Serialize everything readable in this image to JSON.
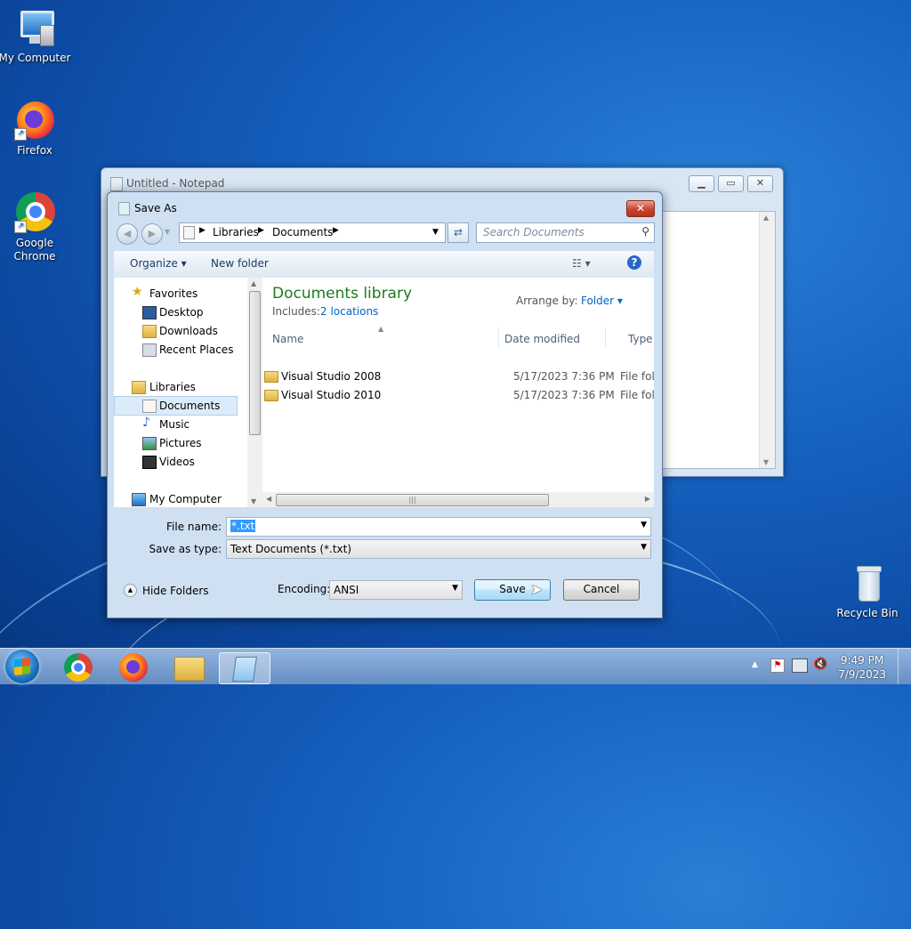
{
  "desktop": {
    "icons": [
      {
        "label": "My Computer",
        "icon": "computer-icon"
      },
      {
        "label": "Firefox",
        "icon": "firefox-icon"
      },
      {
        "label": "Google Chrome",
        "icon": "chrome-icon"
      },
      {
        "label": "Recycle Bin",
        "icon": "recycle-bin-icon"
      }
    ]
  },
  "notepad": {
    "title": "Untitled - Notepad"
  },
  "dialog": {
    "title": "Save As",
    "breadcrumb": [
      "Libraries",
      "Documents"
    ],
    "search_placeholder": "Search Documents",
    "toolbar": {
      "organize": "Organize",
      "new_folder": "New folder"
    },
    "nav": {
      "favorites": "Favorites",
      "desktop": "Desktop",
      "downloads": "Downloads",
      "recent_places": "Recent Places",
      "libraries": "Libraries",
      "documents": "Documents",
      "music": "Music",
      "pictures": "Pictures",
      "videos": "Videos",
      "my_computer": "My Computer"
    },
    "library": {
      "title": "Documents library",
      "includes_label": "Includes:",
      "includes_link": "2 locations",
      "arrange_label": "Arrange by:",
      "arrange_value": "Folder"
    },
    "columns": {
      "name": "Name",
      "date": "Date modified",
      "type": "Type"
    },
    "files": [
      {
        "name": "Visual Studio 2008",
        "date": "5/17/2023 7:36 PM",
        "type": "File folder"
      },
      {
        "name": "Visual Studio 2010",
        "date": "5/17/2023 7:36 PM",
        "type": "File folder"
      }
    ],
    "file_name_label": "File name:",
    "file_name_value": "*.txt",
    "save_type_label": "Save as type:",
    "save_type_value": "Text Documents (*.txt)",
    "hide_folders": "Hide Folders",
    "encoding_label": "Encoding:",
    "encoding_value": "ANSI",
    "save": "Save",
    "cancel": "Cancel"
  },
  "taskbar": {
    "time": "9:49 PM",
    "date": "7/9/2023"
  },
  "colors": {
    "library_title": "#1e7a1e",
    "link": "#0066cc",
    "taskbar": "#8fb3dc"
  }
}
